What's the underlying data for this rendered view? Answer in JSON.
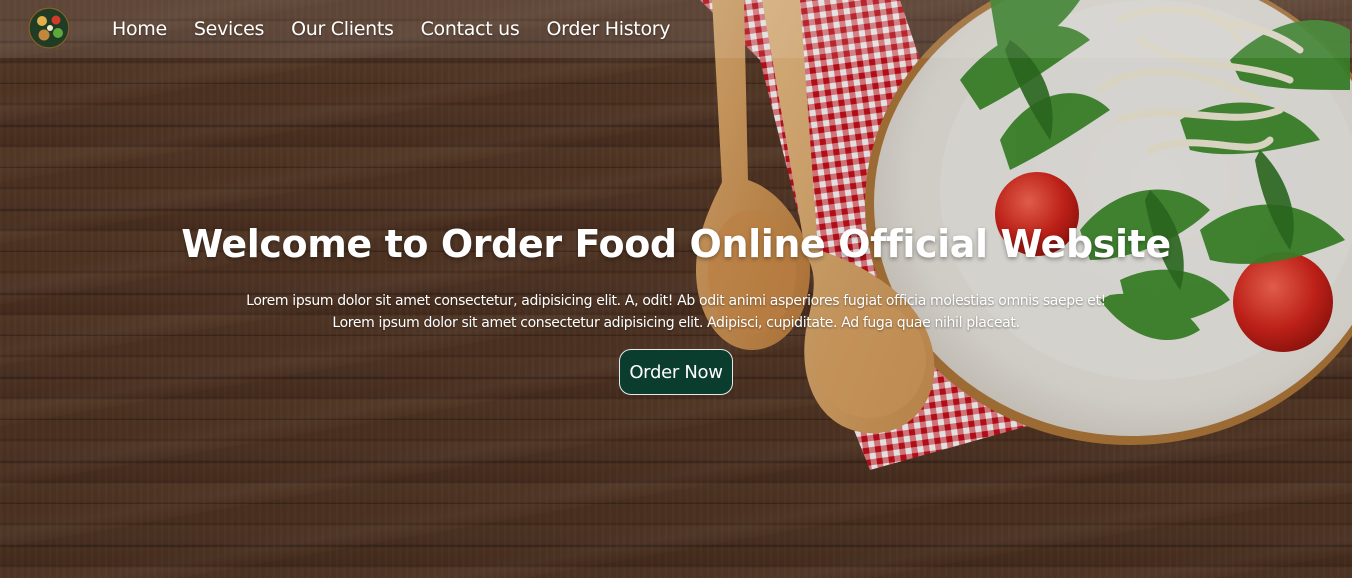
{
  "nav": {
    "logo_icon": "food-bowl-logo-icon",
    "links": [
      "Home",
      "Sevices",
      "Our Clients",
      "Contact us",
      "Order History"
    ]
  },
  "hero": {
    "title": "Welcome to Order Food Online Official Website",
    "description_line1": "Lorem ipsum dolor sit amet consectetur, adipisicing elit. A, odit! Ab odit animi asperiores fugiat officia molestias omnis saepe et!",
    "description_line2": "Lorem ipsum dolor sit amet consectetur adipisicing elit. Adipisci, cupiditate. Ad fuga quae nihil placeat.",
    "button_label": "Order Now",
    "button_color": "#0b3d2e",
    "background_image": "wooden-table-with-spoons-and-salad-plate"
  }
}
